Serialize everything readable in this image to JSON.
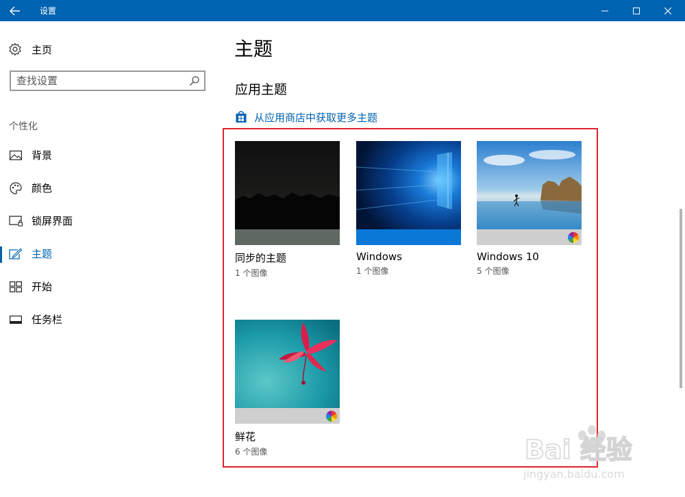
{
  "titlebar": {
    "title": "设置"
  },
  "sidebar": {
    "home_label": "主页",
    "search_placeholder": "查找设置",
    "section_label": "个性化",
    "items": [
      {
        "label": "背景",
        "icon": "picture-icon",
        "active": false
      },
      {
        "label": "颜色",
        "icon": "palette-icon",
        "active": false
      },
      {
        "label": "锁屏界面",
        "icon": "lock-screen-icon",
        "active": false
      },
      {
        "label": "主题",
        "icon": "theme-brush-icon",
        "active": true
      },
      {
        "label": "开始",
        "icon": "start-tiles-icon",
        "active": false
      },
      {
        "label": "任务栏",
        "icon": "taskbar-icon",
        "active": false
      }
    ]
  },
  "main": {
    "title": "主题",
    "subtitle": "应用主题",
    "store_link": "从应用商店中获取更多主题",
    "themes": [
      {
        "name": "同步的主题",
        "count": "1 个图像",
        "has_color_wheel": false
      },
      {
        "name": "Windows",
        "count": "1 个图像",
        "has_color_wheel": false
      },
      {
        "name": "Windows 10",
        "count": "5 个图像",
        "has_color_wheel": true
      },
      {
        "name": "鲜花",
        "count": "6 个图像",
        "has_color_wheel": true
      }
    ]
  },
  "watermark": {
    "text": "Bai 经验",
    "url_text": "jingyan.baidu.com"
  },
  "colors": {
    "accent": "#0063b1",
    "highlight": "#e0202a"
  }
}
